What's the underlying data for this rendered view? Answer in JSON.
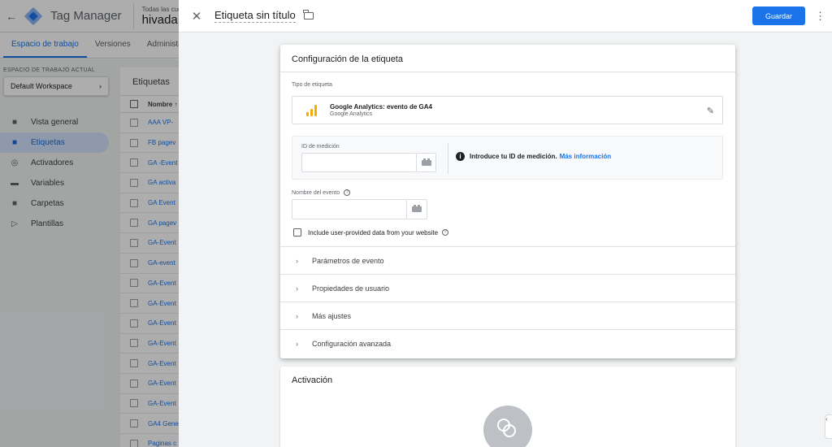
{
  "app": {
    "product_name": "Tag Manager",
    "account_label": "Todas las cuentas",
    "account_name": "hivadaMar"
  },
  "tabs": [
    {
      "label": "Espacio de trabajo",
      "active": true
    },
    {
      "label": "Versiones",
      "active": false
    },
    {
      "label": "Administrad",
      "active": false
    }
  ],
  "sidebar": {
    "workspace_label": "ESPACIO DE TRABAJO ACTUAL",
    "workspace_name": "Default Workspace",
    "items": [
      {
        "label": "Vista general",
        "icon": "briefcase-icon"
      },
      {
        "label": "Etiquetas",
        "icon": "tag-icon",
        "active": true
      },
      {
        "label": "Activadores",
        "icon": "trigger-icon"
      },
      {
        "label": "Variables",
        "icon": "variables-icon"
      },
      {
        "label": "Carpetas",
        "icon": "folder-icon"
      },
      {
        "label": "Plantillas",
        "icon": "template-icon"
      }
    ]
  },
  "tags_list": {
    "title": "Etiquetas",
    "column_name": "Nombre ↑",
    "rows": [
      "AAA VP- ",
      "FB pagev",
      "GA -Event",
      "GA activa",
      "GA Event",
      "GA pagev",
      "GA-Event",
      "GA-event",
      "GA-Event",
      "GA-Event",
      "GA-Event",
      "GA-Event",
      "GA-Event",
      "GA-Event",
      "GA-Event",
      "GA4 Gene",
      "Paginas c"
    ]
  },
  "editor": {
    "title": "Etiqueta sin título",
    "save_label": "Guardar",
    "config_card": {
      "title": "Configuración de la etiqueta",
      "tag_type_label": "Tipo de etiqueta",
      "tag_type_name": "Google Analytics: evento de GA4",
      "tag_type_sub": "Google Analytics",
      "measurement_label": "ID de medición",
      "measurement_value": "",
      "measurement_info": "Introduce tu ID de medición.",
      "measurement_link": "Más información",
      "event_name_label": "Nombre del evento",
      "event_name_value": "",
      "user_data_label": "Include user-provided data from your website",
      "sections": [
        "Parámetros de evento",
        "Propiedades de usuario",
        "Más ajustes",
        "Configuración avanzada"
      ]
    },
    "trigger_card": {
      "title": "Activación"
    }
  },
  "colors": {
    "primary": "#1a73e8",
    "ga_orange": "#f9ab00",
    "sidebar_active": "#d2e3fc"
  }
}
